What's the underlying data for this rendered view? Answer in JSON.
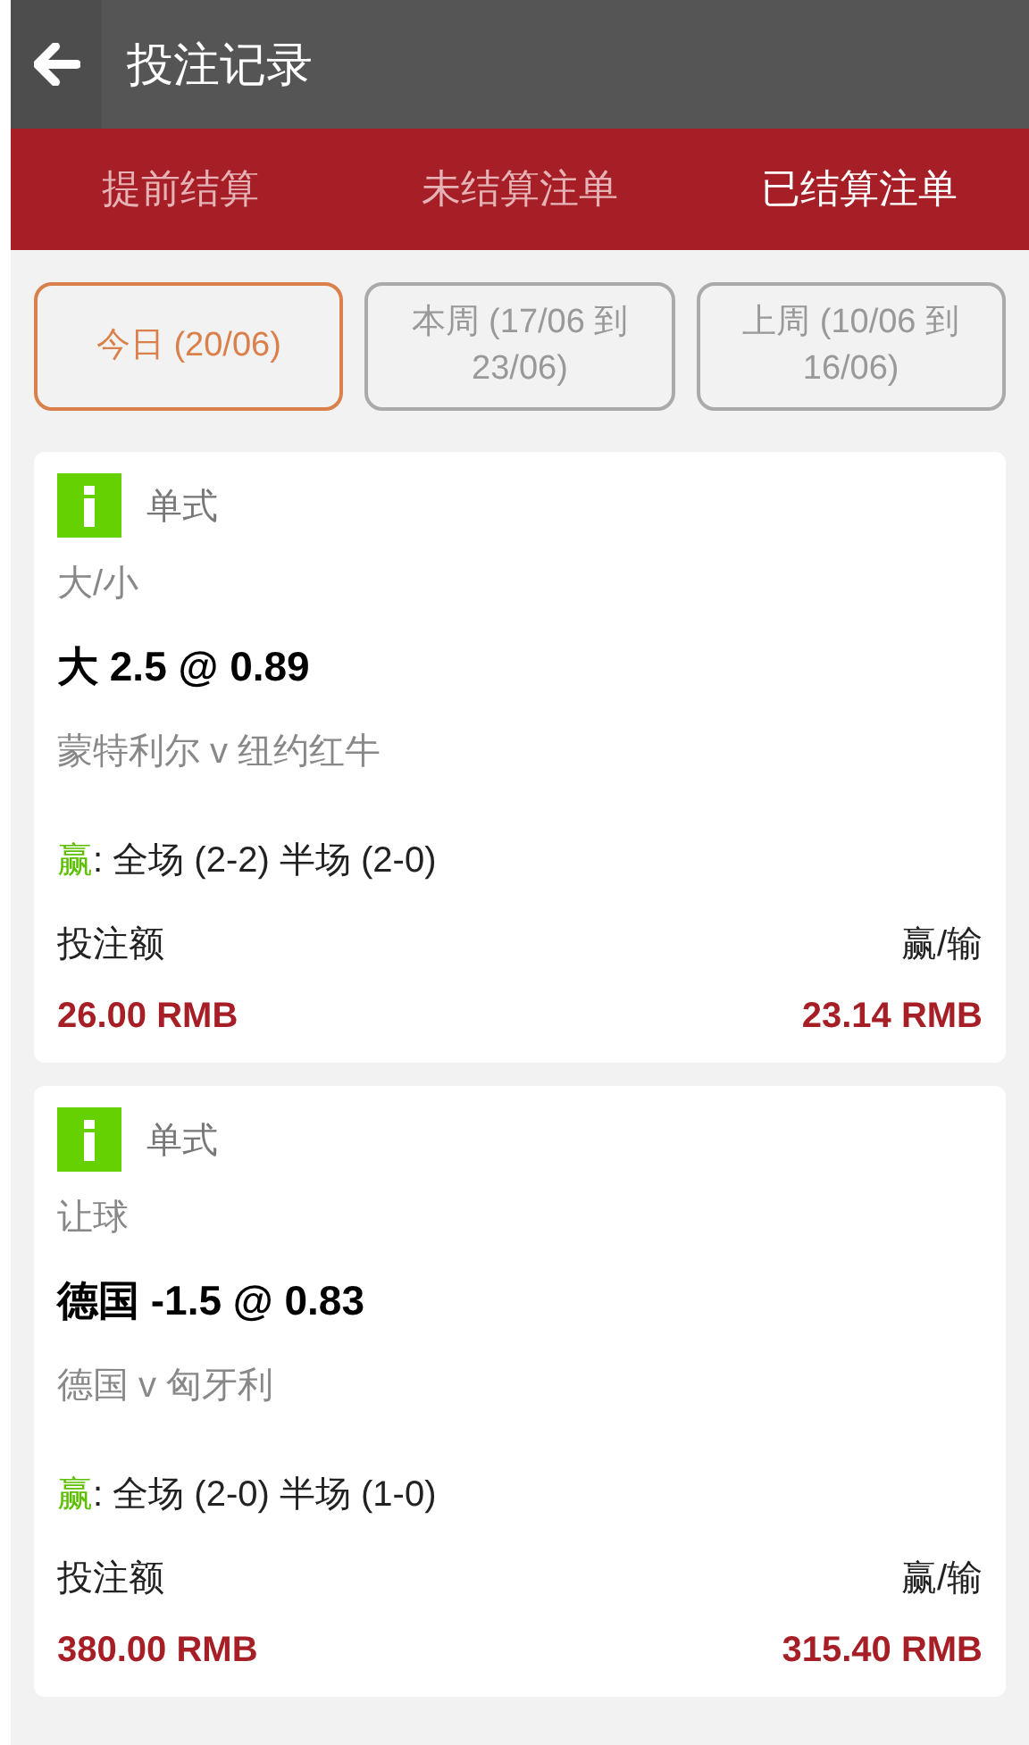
{
  "header": {
    "title": "投注记录"
  },
  "tabs": [
    {
      "label": "提前结算",
      "selected": false
    },
    {
      "label": "未结算注单",
      "selected": false
    },
    {
      "label": "已结算注单",
      "selected": true
    }
  ],
  "filters": [
    {
      "label": "今日 (20/06)",
      "selected": true
    },
    {
      "label": "本周 (17/06 到 23/06)",
      "selected": false
    },
    {
      "label": "上周 (10/06 到 16/06)",
      "selected": false
    }
  ],
  "bets": [
    {
      "type": "单式",
      "market": "大/小",
      "selection": "大 2.5 @ 0.89",
      "match": "蒙特利尔 v 纽约红牛",
      "result": {
        "label": "赢",
        "color": "#5cbf00",
        "detail": ": 全场 (2-2) 半场 (2-0)"
      },
      "stake_label": "投注额",
      "stake": "26.00 RMB",
      "winloss_label": "赢/输",
      "winloss": "23.14 RMB"
    },
    {
      "type": "单式",
      "market": "让球",
      "selection": "德国 -1.5 @ 0.83",
      "match": "德国 v 匈牙利",
      "result": {
        "label": "赢",
        "color": "#5cbf00",
        "detail": ": 全场 (2-0) 半场 (1-0)"
      },
      "stake_label": "投注额",
      "stake": "380.00 RMB",
      "winloss_label": "赢/输",
      "winloss": "315.40 RMB"
    }
  ]
}
